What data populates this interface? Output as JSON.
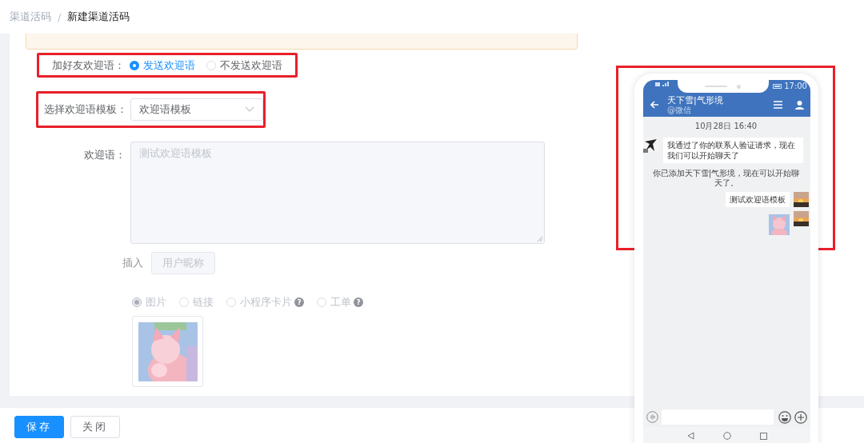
{
  "breadcrumb": {
    "separator": "/",
    "items": [
      {
        "label": "渠道活码",
        "current": false
      },
      {
        "label": "新建渠道活码",
        "current": true
      }
    ]
  },
  "form": {
    "greeting_switch": {
      "label": "加好友欢迎语：",
      "highlighted": true,
      "options": [
        {
          "label": "发送欢迎语",
          "selected": true
        },
        {
          "label": "不发送欢迎语",
          "selected": false
        }
      ]
    },
    "template_select": {
      "label": "选择欢迎语模板：",
      "highlighted": true,
      "value": "欢迎语模板"
    },
    "greeting": {
      "label": "欢迎语：",
      "value": "测试欢迎语模板",
      "disabled": true
    },
    "insert": {
      "label": "插入",
      "button": "用户昵称",
      "disabled": true
    },
    "attachment_types": [
      {
        "label": "图片",
        "selected": true,
        "disabled": true
      },
      {
        "label": "链接",
        "selected": false,
        "disabled": true
      },
      {
        "label": "小程序卡片",
        "selected": false,
        "disabled": true,
        "help": "?"
      },
      {
        "label": "工单",
        "selected": false,
        "disabled": true,
        "help": "?"
      }
    ]
  },
  "buttons": [
    {
      "label": "保存",
      "kind": "primary"
    },
    {
      "label": "关闭",
      "kind": "default"
    }
  ],
  "preview": {
    "highlighted": true,
    "status_time": "17:00",
    "contact": "天下雪|气形境",
    "contact_sub": "@微信",
    "timestamp": "10月28日 16:40",
    "messages": [
      {
        "kind": "received",
        "text": "我通过了你的联系人验证请求，现在我们可以开始聊天了"
      },
      {
        "kind": "system",
        "text": "你已添加天下雪|气形境，现在可以开始聊天了。"
      },
      {
        "kind": "sent_text",
        "text": "测试欢迎语模板"
      },
      {
        "kind": "sent_image"
      }
    ]
  }
}
